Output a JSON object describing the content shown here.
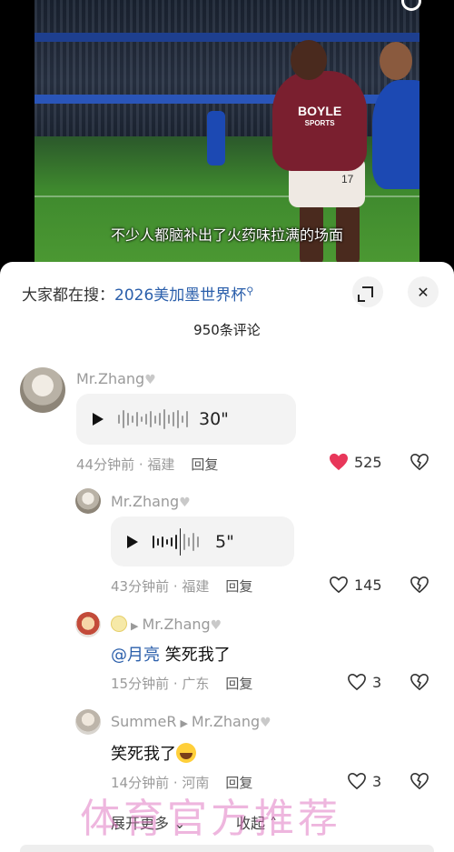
{
  "video": {
    "subtitle": "不少人都脑补出了火药味拉满的场面",
    "sponsor_line1": "BOYLE",
    "sponsor_line2": "SPORTS",
    "shirt_number": "17"
  },
  "sheet": {
    "search_prefix": "大家都在搜：",
    "search_term": "2026美加墨世界杯",
    "comment_count": "950条评论",
    "close_label": "✕"
  },
  "comments": [
    {
      "name": "Mr.Zhang",
      "voice_duration": "30\"",
      "time": "44分钟前 · 福建",
      "reply_label": "回复",
      "likes": "525",
      "liked": true
    },
    {
      "name": "Mr.Zhang",
      "voice_duration": "5\"",
      "time": "43分钟前 · 福建",
      "reply_label": "回复",
      "likes": "145"
    },
    {
      "reply_to": "Mr.Zhang",
      "mention": "@月亮",
      "text": "笑死我了",
      "time": "15分钟前 · 广东",
      "reply_label": "回复",
      "likes": "3"
    },
    {
      "name": "SummeR",
      "reply_to": "Mr.Zhang",
      "text": "笑死我了",
      "time": "14分钟前 · 河南",
      "reply_label": "回复",
      "likes": "3"
    }
  ],
  "footer": {
    "expand_more": "展开更多",
    "collapse": "收起",
    "watermark": "体育官方推荐"
  },
  "colors": {
    "accent_blue": "#2b5fab",
    "like_red": "#e8375a"
  }
}
